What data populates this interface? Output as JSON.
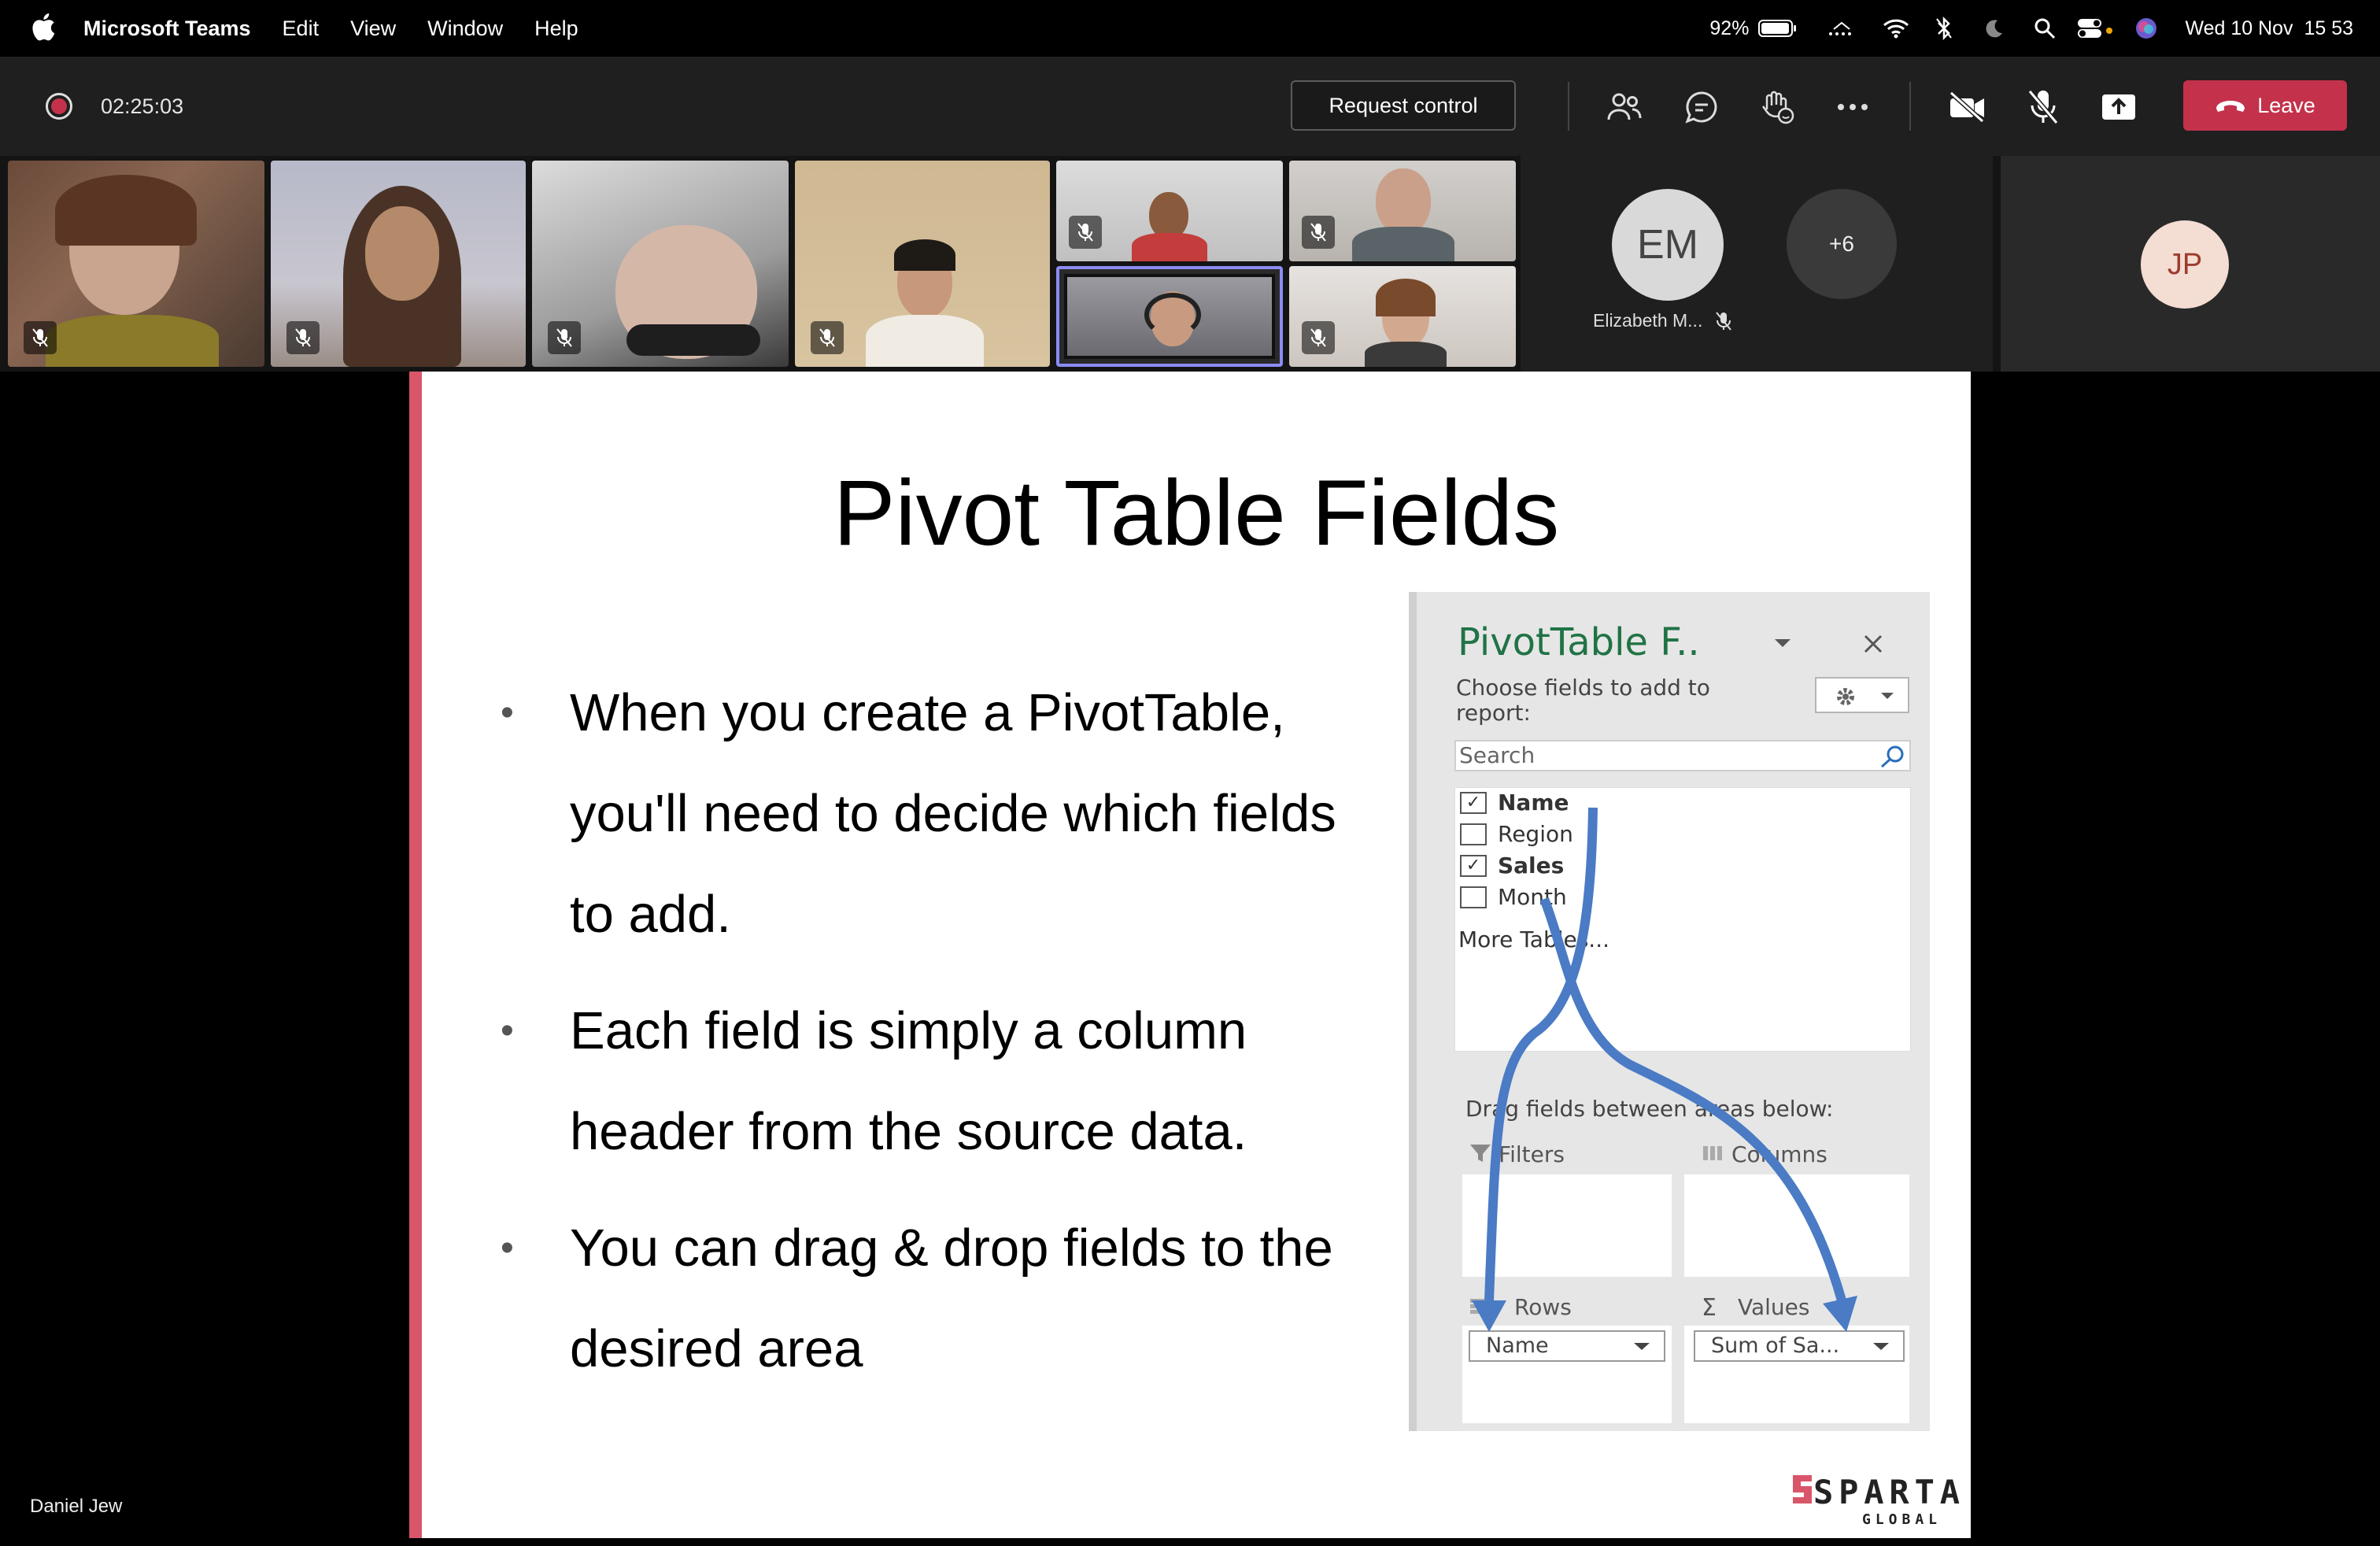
{
  "menubar": {
    "app_name": "Microsoft Teams",
    "menus": [
      "Edit",
      "View",
      "Window",
      "Help"
    ],
    "battery": "92%",
    "clock": "Wed 10 Nov  15 53"
  },
  "controls": {
    "timer": "02:25:03",
    "request_control": "Request control",
    "leave": "Leave",
    "leave_color": "#c4314b"
  },
  "participants": {
    "em_initials": "EM",
    "em_name": "Elizabeth M...",
    "more_count": "+6",
    "jp_initials": "JP"
  },
  "slide": {
    "title": "Pivot Table Fields",
    "bullets": [
      "When you create a PivotTable, you'll need to decide which fields to add.",
      "Each field is simply a column header from the source data.",
      "You can drag & drop fields to the desired area"
    ],
    "accent": "#d9566a",
    "logo_main": "SPARTA",
    "logo_sub": "GLOBAL"
  },
  "pivot_pane": {
    "title": "PivotTable F..",
    "choose": "Choose fields to add to report:",
    "search_placeholder": "Search",
    "fields": [
      {
        "label": "Name",
        "checked": true
      },
      {
        "label": "Region",
        "checked": false
      },
      {
        "label": "Sales",
        "checked": true
      },
      {
        "label": "Month",
        "checked": false
      }
    ],
    "more_tables": "More Tables...",
    "drag_text": "Drag fields between areas below:",
    "areas": {
      "filters": "Filters",
      "columns": "Columns",
      "rows": "Rows",
      "values": "Values"
    },
    "rows_value": "Name",
    "values_value": "Sum of Sa...",
    "arrow_color": "#4a7bc4"
  },
  "presenter_name": "Daniel Jew"
}
